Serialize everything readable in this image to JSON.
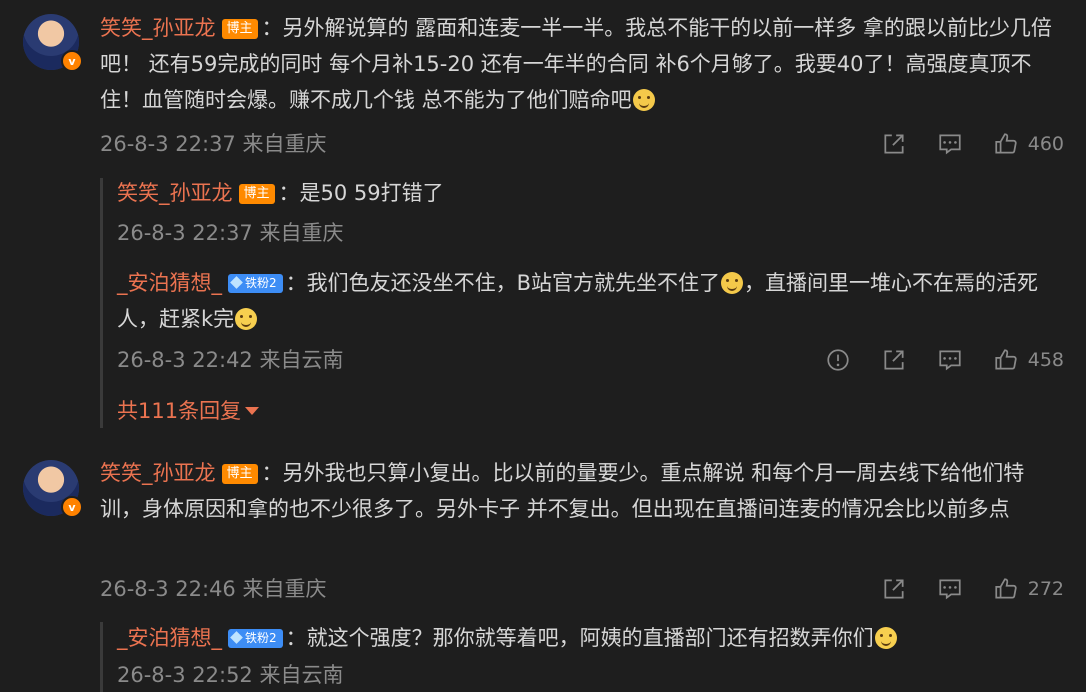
{
  "comments": [
    {
      "user": "笑笑_孙亚龙",
      "tag": "博主",
      "text": "：另外解说算的 露面和连麦一半一半。我总不能干的以前一样多 拿的跟以前比少几倍吧！ 还有59完成的同时 每个月补15-20 还有一年半的合同 补6个月够了。我要40了！高强度真顶不住！血管随时会爆。赚不成几个钱 总不能为了他们赔命吧",
      "time": "26-8-3 22:37 来自重庆",
      "likes": "460",
      "replies": [
        {
          "user": "笑笑_孙亚龙",
          "tag": "博主",
          "text": "：是50 59打错了",
          "time": "26-8-3 22:37 来自重庆"
        },
        {
          "user": "_安泊猜想_",
          "tag": "铁粉2",
          "text": "：我们色友还没坐不住，B站官方就先坐不住了",
          "text2": "，直播间里一堆心不在焉的活死人，赶紧k完",
          "time": "26-8-3 22:42 来自云南",
          "likes": "458"
        }
      ],
      "more_replies": "共111条回复"
    },
    {
      "user": "笑笑_孙亚龙",
      "tag": "博主",
      "text": "：另外我也只算小复出。比以前的量要少。重点解说 和每个月一周去线下给他们特训，身体原因和拿的也不少很多了。另外卡子 并不复出。但出现在直播间连麦的情况会比以前多点",
      "time": "26-8-3 22:46 来自重庆",
      "likes": "272",
      "replies": [
        {
          "user": "_安泊猜想_",
          "tag": "铁粉2",
          "text": "：就这个强度？那你就等着吧，阿姨的直播部门还有招数弄你们",
          "time": "26-8-3 22:52 来自云南"
        }
      ]
    }
  ],
  "icons": {
    "verified_badge": "v",
    "share": "share-icon",
    "comment": "comment-icon",
    "like": "like-icon",
    "report": "report-icon"
  }
}
